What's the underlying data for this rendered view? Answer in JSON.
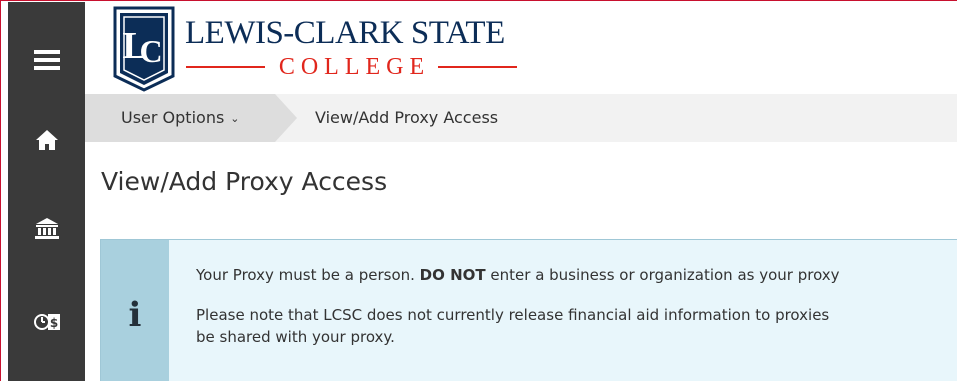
{
  "sidebar": {
    "items": [
      {
        "icon": "menu-icon"
      },
      {
        "icon": "home-icon"
      },
      {
        "icon": "bank-icon"
      },
      {
        "icon": "clock-dollar-icon"
      }
    ]
  },
  "header": {
    "logo_line1": "LEWIS-CLARK STATE",
    "logo_line2": "COLLEGE",
    "logo_monogram": "LC",
    "brand_navy": "#0c2d57",
    "brand_red": "#e1261c"
  },
  "breadcrumb": {
    "first_label": "User Options",
    "current_label": "View/Add Proxy Access"
  },
  "page": {
    "title": "View/Add Proxy Access"
  },
  "notice": {
    "icon": "info-icon",
    "line1_pre": "Your Proxy must be a person. ",
    "line1_bold": "DO NOT",
    "line1_post": " enter a business or organization as your proxy",
    "line2": "Please note that LCSC does not currently release financial aid information to proxies",
    "line3": "be shared with your proxy."
  }
}
